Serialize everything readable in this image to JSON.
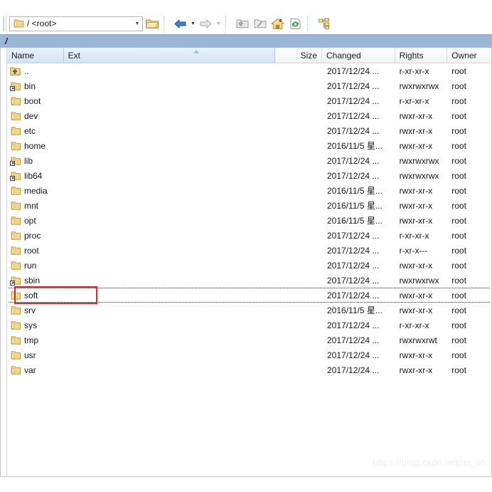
{
  "toolbar": {
    "path_combo": {
      "value": "/ <root>",
      "icon": "folder-icon",
      "dropdown_icon": "chevron-down-icon"
    },
    "buttons": [
      {
        "name": "open-directory-button",
        "icon": "open-folder-icon",
        "label": ""
      },
      {
        "name": "back-button",
        "icon": "back-arrow-icon",
        "label": ""
      },
      {
        "name": "back-history-dropdown",
        "icon": "chevron-down-icon",
        "label": ""
      },
      {
        "name": "forward-button",
        "icon": "forward-arrow-icon",
        "label": ""
      },
      {
        "name": "forward-history-dropdown",
        "icon": "chevron-down-icon",
        "label": ""
      },
      {
        "name": "parent-directory-button",
        "icon": "folder-up-icon",
        "label": ""
      },
      {
        "name": "root-directory-button",
        "icon": "folder-root-icon",
        "label": ""
      },
      {
        "name": "home-directory-button",
        "icon": "home-icon",
        "label": ""
      },
      {
        "name": "refresh-button",
        "icon": "refresh-icon",
        "label": ""
      },
      {
        "name": "directory-tree-button",
        "icon": "tree-icon",
        "label": ""
      }
    ]
  },
  "pathbar": {
    "current_path": "/"
  },
  "columns": [
    {
      "key": "name",
      "label": "Name"
    },
    {
      "key": "ext",
      "label": "Ext"
    },
    {
      "key": "size",
      "label": "Size"
    },
    {
      "key": "changed",
      "label": "Changed"
    },
    {
      "key": "rights",
      "label": "Rights"
    },
    {
      "key": "owner",
      "label": "Owner"
    }
  ],
  "sort": {
    "column": "name",
    "direction": "ascending",
    "icon": "sort-ascending-icon"
  },
  "rows": [
    {
      "name": "..",
      "icon": "folder-up-icon",
      "ext": "",
      "size": "",
      "changed": "2017/12/24 ...",
      "rights": "r-xr-xr-x",
      "owner": "root"
    },
    {
      "name": "bin",
      "icon": "folder-link-icon",
      "ext": "",
      "size": "",
      "changed": "2017/12/24 ...",
      "rights": "rwxrwxrwx",
      "owner": "root"
    },
    {
      "name": "boot",
      "icon": "folder-icon",
      "ext": "",
      "size": "",
      "changed": "2017/12/24 ...",
      "rights": "r-xr-xr-x",
      "owner": "root"
    },
    {
      "name": "dev",
      "icon": "folder-icon",
      "ext": "",
      "size": "",
      "changed": "2017/12/24 ...",
      "rights": "rwxr-xr-x",
      "owner": "root"
    },
    {
      "name": "etc",
      "icon": "folder-icon",
      "ext": "",
      "size": "",
      "changed": "2017/12/24 ...",
      "rights": "rwxr-xr-x",
      "owner": "root"
    },
    {
      "name": "home",
      "icon": "folder-icon",
      "ext": "",
      "size": "",
      "changed": "2016/11/5 星...",
      "rights": "rwxr-xr-x",
      "owner": "root"
    },
    {
      "name": "lib",
      "icon": "folder-link-icon",
      "ext": "",
      "size": "",
      "changed": "2017/12/24 ...",
      "rights": "rwxrwxrwx",
      "owner": "root"
    },
    {
      "name": "lib64",
      "icon": "folder-link-icon",
      "ext": "",
      "size": "",
      "changed": "2017/12/24 ...",
      "rights": "rwxrwxrwx",
      "owner": "root"
    },
    {
      "name": "media",
      "icon": "folder-icon",
      "ext": "",
      "size": "",
      "changed": "2016/11/5 星...",
      "rights": "rwxr-xr-x",
      "owner": "root"
    },
    {
      "name": "mnt",
      "icon": "folder-icon",
      "ext": "",
      "size": "",
      "changed": "2016/11/5 星...",
      "rights": "rwxr-xr-x",
      "owner": "root"
    },
    {
      "name": "opt",
      "icon": "folder-icon",
      "ext": "",
      "size": "",
      "changed": "2016/11/5 星...",
      "rights": "rwxr-xr-x",
      "owner": "root"
    },
    {
      "name": "proc",
      "icon": "folder-icon",
      "ext": "",
      "size": "",
      "changed": "2017/12/24 ...",
      "rights": "r-xr-xr-x",
      "owner": "root"
    },
    {
      "name": "root",
      "icon": "folder-icon",
      "ext": "",
      "size": "",
      "changed": "2017/12/24 ...",
      "rights": "r-xr-x---",
      "owner": "root"
    },
    {
      "name": "run",
      "icon": "folder-icon",
      "ext": "",
      "size": "",
      "changed": "2017/12/24 ...",
      "rights": "rwxr-xr-x",
      "owner": "root"
    },
    {
      "name": "sbin",
      "icon": "folder-link-icon",
      "ext": "",
      "size": "",
      "changed": "2017/12/24 ...",
      "rights": "rwxrwxrwx",
      "owner": "root"
    },
    {
      "name": "soft",
      "icon": "folder-icon",
      "ext": "",
      "size": "",
      "changed": "2017/12/24 ...",
      "rights": "rwxr-xr-x",
      "owner": "root",
      "focused": true,
      "annotated": true
    },
    {
      "name": "srv",
      "icon": "folder-icon",
      "ext": "",
      "size": "",
      "changed": "2016/11/5 星...",
      "rights": "rwxr-xr-x",
      "owner": "root"
    },
    {
      "name": "sys",
      "icon": "folder-icon",
      "ext": "",
      "size": "",
      "changed": "2017/12/24 ...",
      "rights": "r-xr-xr-x",
      "owner": "root"
    },
    {
      "name": "tmp",
      "icon": "folder-icon",
      "ext": "",
      "size": "",
      "changed": "2017/12/24 ...",
      "rights": "rwxrwxrwt",
      "owner": "root"
    },
    {
      "name": "usr",
      "icon": "folder-icon",
      "ext": "",
      "size": "",
      "changed": "2017/12/24 ...",
      "rights": "rwxr-xr-x",
      "owner": "root"
    },
    {
      "name": "var",
      "icon": "folder-icon",
      "ext": "",
      "size": "",
      "changed": "2017/12/24 ...",
      "rights": "rwxr-xr-x",
      "owner": "root"
    }
  ],
  "annotation": {
    "color": "#e02b2b",
    "target_row": "soft"
  },
  "watermark": {
    "text": "https://blog.csdn.net/lei_lin",
    "color": "#eef1f3"
  },
  "colors": {
    "pathbar_bg": "#9bb7d4",
    "header_selected_bg": "#d2e4f4",
    "folder_yellow": "#f5d88a",
    "accent": "#2a6fb5"
  }
}
